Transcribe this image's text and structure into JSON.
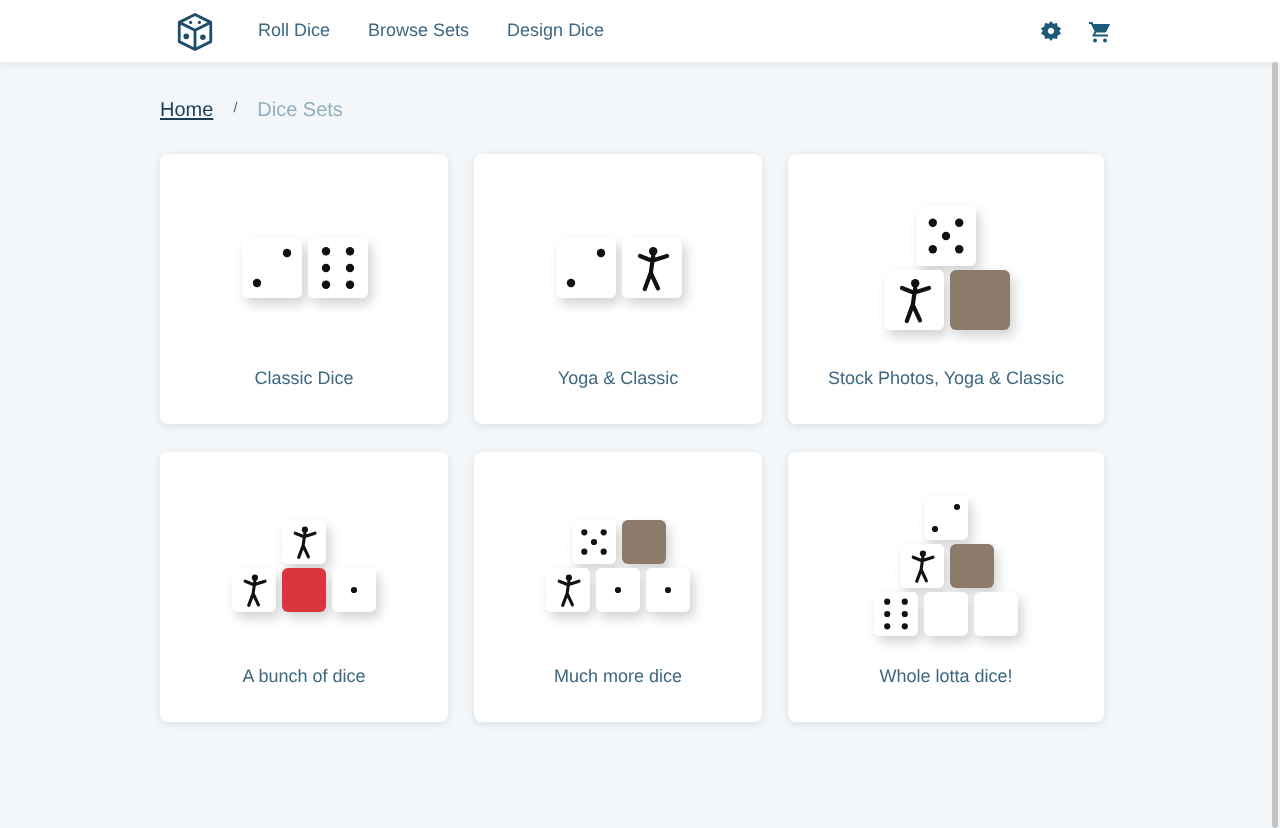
{
  "nav": {
    "links": [
      {
        "label": "Roll Dice"
      },
      {
        "label": "Browse Sets"
      },
      {
        "label": "Design Dice"
      }
    ]
  },
  "breadcrumb": [
    {
      "label": "Home",
      "kind": "link"
    },
    {
      "label": "Dice Sets",
      "kind": "current"
    }
  ],
  "separator": "/",
  "dice_sets": [
    {
      "title": "Classic Dice"
    },
    {
      "title": "Yoga & Classic"
    },
    {
      "title": "Stock Photos, Yoga & Classic"
    },
    {
      "title": "A bunch of dice"
    },
    {
      "title": "Much more dice"
    },
    {
      "title": "Whole lotta dice!"
    }
  ]
}
